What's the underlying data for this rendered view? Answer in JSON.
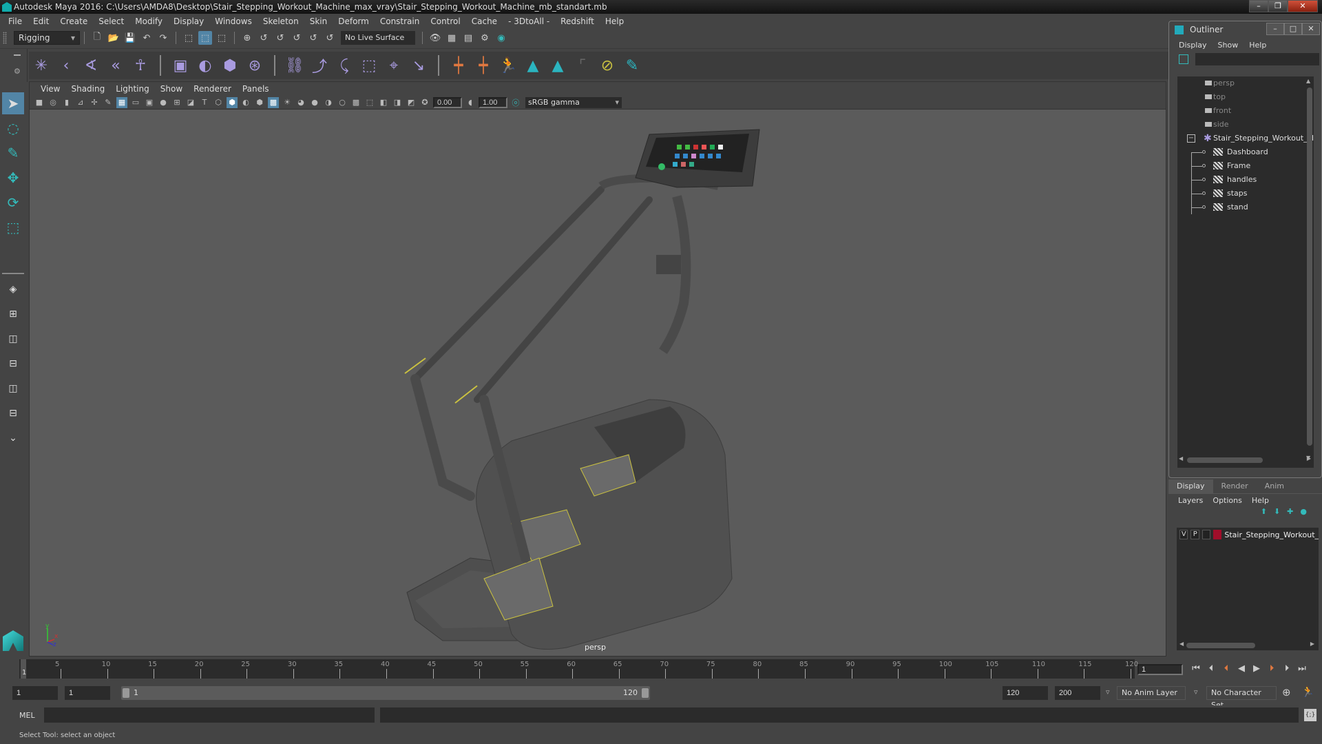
{
  "window": {
    "title": "Autodesk Maya 2016: C:\\Users\\AMDA8\\Desktop\\Stair_Stepping_Workout_Machine_max_vray\\Stair_Stepping_Workout_Machine_mb_standart.mb",
    "minimize": "–",
    "restore": "❐",
    "close": "✕"
  },
  "menubar": [
    "File",
    "Edit",
    "Create",
    "Select",
    "Modify",
    "Display",
    "Windows",
    "Skeleton",
    "Skin",
    "Deform",
    "Constrain",
    "Control",
    "Cache",
    "- 3DtoAll -",
    "Redshift",
    "Help"
  ],
  "statusline": {
    "mode": "Rigging",
    "live_surface": "No Live Surface"
  },
  "panel": {
    "menu": [
      "View",
      "Shading",
      "Lighting",
      "Show",
      "Renderer",
      "Panels"
    ],
    "exposure": "0.00",
    "gamma_value": "1.00",
    "color_space": "sRGB gamma",
    "camera_label": "persp"
  },
  "outliner": {
    "title": "Outliner",
    "menu": [
      "Display",
      "Show",
      "Help"
    ],
    "filter_value": "",
    "cameras": [
      "persp",
      "top",
      "front",
      "side"
    ],
    "group": "Stair_Stepping_Workout_Machine",
    "children": [
      "Dashboard",
      "Frame",
      "handles",
      "staps",
      "stand"
    ]
  },
  "layers": {
    "tabs": [
      "Display",
      "Render",
      "Anim"
    ],
    "active_tab": "Display",
    "menu": [
      "Layers",
      "Options",
      "Help"
    ],
    "rows": [
      {
        "v": "V",
        "p": "P",
        "name": "Stair_Stepping_Workout_Machine",
        "color": "#a00e2a"
      }
    ]
  },
  "timeline": {
    "start": 1,
    "end": 120,
    "ticks": [
      5,
      10,
      15,
      20,
      25,
      30,
      35,
      40,
      45,
      50,
      55,
      60,
      65,
      70,
      75,
      80,
      85,
      90,
      95,
      100,
      105,
      110,
      115,
      120
    ],
    "current_frame": "1",
    "current_frame_field": "1"
  },
  "range": {
    "start_field": "1",
    "playback_start": "1",
    "slider_start": "1",
    "slider_end": "120",
    "playback_end": "120",
    "end_field": "200",
    "anim_layer": "No Anim Layer",
    "character_set": "No Character Set"
  },
  "cmdline": {
    "label": "MEL",
    "value": "",
    "result": ""
  },
  "help_line": "Select Tool: select an object"
}
